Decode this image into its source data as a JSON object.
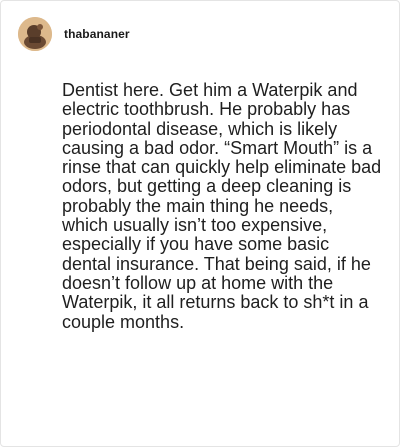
{
  "post": {
    "username": "thabananer",
    "avatar_icon": "avatar-icon",
    "comment_text": "Dentist here. Get him a Waterpik and electric toothbrush. He probably has periodontal disease, which is likely causing a bad odor. “Smart Mouth” is a rinse that can quickly help eliminate bad odors, but getting a deep cleaning is probably the main thing he needs, which usually isn’t too expensive, especially if you have some basic dental insurance. That being said, if he doesn’t follow up at home with the Waterpik, it all returns back to sh*t in a couple months."
  },
  "colors": {
    "avatar_background": "#ddb98c",
    "avatar_figure": "#5a3e2b",
    "text": "#1f1f1f",
    "border": "#e4e4e4"
  }
}
